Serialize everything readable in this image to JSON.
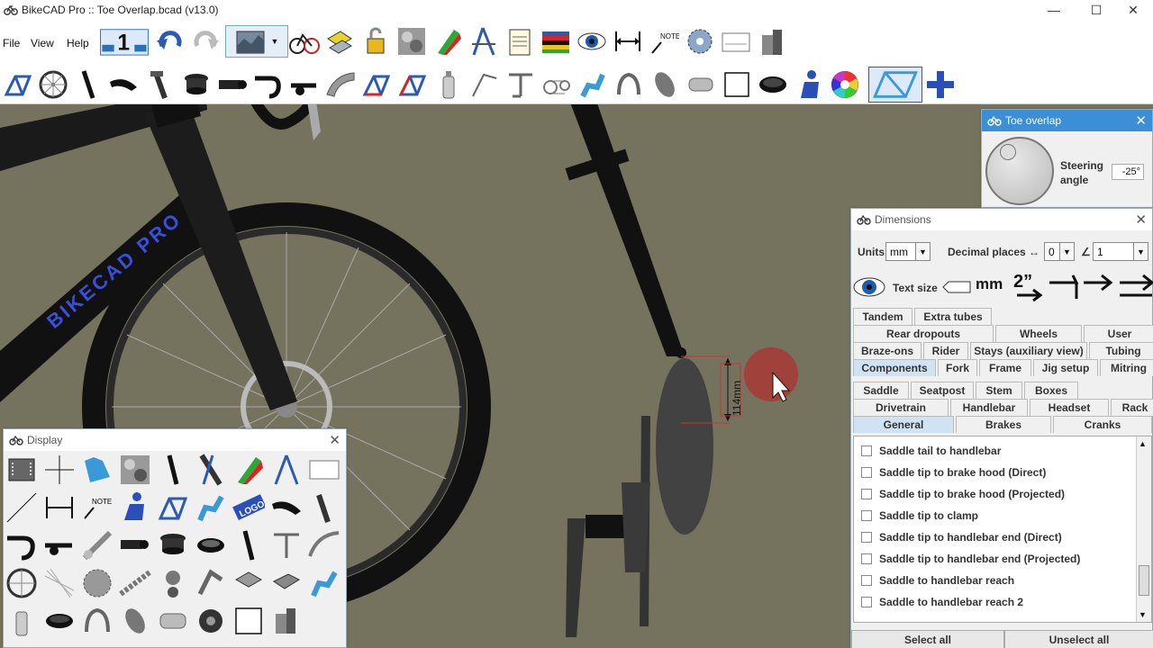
{
  "window": {
    "title": "BikeCAD Pro :: Toe Overlap.bcad (v13.0)",
    "minimize": "—",
    "maximize": "☐",
    "close": "✕"
  },
  "menu": {
    "file": "File",
    "view": "View",
    "help": "Help"
  },
  "canvas": {
    "brand_text": "BIKECAD PRO",
    "dimension_label": "114mm"
  },
  "toe_overlap": {
    "title": "Toe overlap",
    "close": "✕",
    "steering_label_1": "Steering",
    "steering_label_2": "angle",
    "steering_value": "-25°"
  },
  "dimensions": {
    "title": "Dimensions",
    "close": "✕",
    "units_label": "Units",
    "units_value": "mm",
    "decimal_label": "Decimal places ↔",
    "decimal_value": "0",
    "angle_symbol": "∠",
    "angle_value": "1",
    "text_size_label": "Text size",
    "tabs_row1": [
      "Tandem",
      "Extra tubes"
    ],
    "tabs_row2": [
      "Rear dropouts",
      "Wheels",
      "User"
    ],
    "tabs_row3": [
      "Braze-ons",
      "Rider",
      "Stays (auxiliary view)",
      "Tubing"
    ],
    "tabs_row4": [
      "Components",
      "Fork",
      "Frame",
      "Jig setup",
      "Mitring"
    ],
    "subtabs_row1": [
      "Saddle",
      "Seatpost",
      "Stem",
      "Boxes"
    ],
    "subtabs_row2": [
      "Drivetrain",
      "Handlebar",
      "Headset",
      "Rack"
    ],
    "subtabs_row3": [
      "General",
      "Brakes",
      "Cranks"
    ],
    "items": [
      "Saddle tail to handlebar",
      "Saddle tip to brake hood (Direct)",
      "Saddle tip to brake hood (Projected)",
      "Saddle tip to clamp",
      "Saddle tip to handlebar end (Direct)",
      "Saddle tip to handlebar end (Projected)",
      "Saddle to handlebar reach",
      "Saddle to handlebar reach 2"
    ],
    "select_all": "Select all",
    "unselect_all": "Unselect all"
  },
  "display": {
    "title": "Display",
    "close": "✕",
    "logo_text": "LOGO",
    "note_text": "NOTE"
  },
  "toolbar": {
    "note_text": "NOTE"
  },
  "colors": {
    "canvas_bg": "#75735d",
    "accent": "#3c8fd6",
    "brand_blue": "#3a4fd8"
  }
}
